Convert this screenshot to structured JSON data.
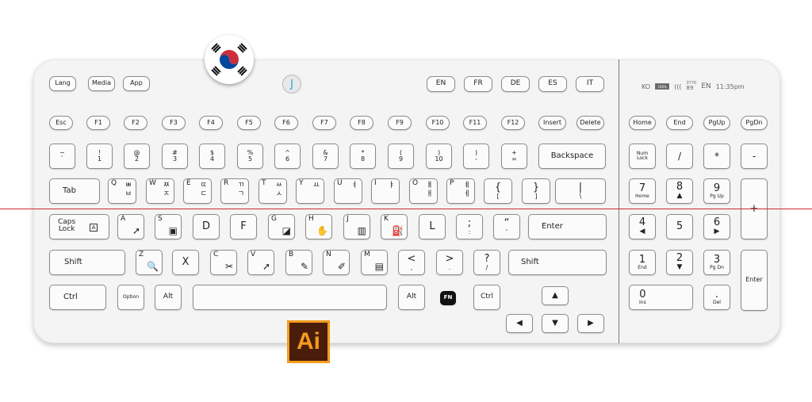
{
  "top_row": {
    "lang": "Lang",
    "media": "Media",
    "app": "App"
  },
  "languages": [
    "EN",
    "FR",
    "DE",
    "ES",
    "IT"
  ],
  "j_button": "J",
  "status": {
    "locale": "KO",
    "battery": "100%",
    "signal": "(((",
    "lat_top": "3770",
    "lat_bottom": "89",
    "lang": "EN",
    "time": "11:35pm"
  },
  "fn_row": [
    "Esc",
    "F1",
    "F2",
    "F3",
    "F4",
    "F5",
    "F6",
    "F7",
    "F8",
    "F9",
    "F10",
    "F11",
    "F12",
    "Insert",
    "Delete"
  ],
  "nav_row": [
    "Home",
    "End",
    "PgUp",
    "PgDn"
  ],
  "num_row": [
    {
      "hi": "~",
      "lo": "`"
    },
    {
      "hi": "!",
      "lo": "1"
    },
    {
      "hi": "@",
      "lo": "2"
    },
    {
      "hi": "#",
      "lo": "3"
    },
    {
      "hi": "$",
      "lo": "4"
    },
    {
      "hi": "%",
      "lo": "5"
    },
    {
      "hi": "^",
      "lo": "6"
    },
    {
      "hi": "&",
      "lo": "7"
    },
    {
      "hi": "*",
      "lo": "8"
    },
    {
      "hi": "(",
      "lo": "9"
    },
    {
      "hi": ")",
      "lo": "10"
    },
    {
      "hi": ")",
      "lo": "-"
    },
    {
      "hi": "+",
      "lo": "="
    }
  ],
  "backspace": "Backspace",
  "tab": "Tab",
  "q_row": [
    {
      "en": "Q",
      "ko1": "ㅃ",
      "ko2": "ㅂ"
    },
    {
      "en": "W",
      "ko1": "ㅉ",
      "ko2": "ㅈ"
    },
    {
      "en": "E",
      "ko1": "ㄸ",
      "ko2": "ㄷ"
    },
    {
      "en": "R",
      "ko1": "ㄲ",
      "ko2": "ㄱ"
    },
    {
      "en": "T",
      "ko1": "ㅆ",
      "ko2": "ㅅ"
    },
    {
      "en": "Y",
      "ko1": "",
      "ko2": "ㅛ"
    },
    {
      "en": "U",
      "ko1": "",
      "ko2": "ㅕ"
    },
    {
      "en": "I",
      "ko1": "",
      "ko2": "ㅑ"
    },
    {
      "en": "O",
      "ko1": "ㅒ",
      "ko2": "ㅐ"
    },
    {
      "en": "P",
      "ko1": "ㅖ",
      "ko2": "ㅔ"
    }
  ],
  "brackets": [
    {
      "hi": "{",
      "lo": "["
    },
    {
      "hi": "}",
      "lo": "]"
    },
    {
      "hi": "|",
      "lo": "\\"
    }
  ],
  "caps": {
    "line1": "Caps",
    "line2": "Lock",
    "badge": "A"
  },
  "a_row": [
    {
      "en": "A",
      "icon": "➚"
    },
    {
      "en": "S",
      "icon": "▣"
    },
    {
      "en": "",
      "big": "D"
    },
    {
      "en": "",
      "big": "F"
    },
    {
      "en": "G",
      "icon": "◪"
    },
    {
      "en": "H",
      "icon": "✋"
    },
    {
      "en": "J",
      "icon": "▥"
    },
    {
      "en": "K",
      "icon": "⛽"
    },
    {
      "en": "",
      "big": "L"
    }
  ],
  "a_punct": [
    {
      "hi": ";",
      "lo": ":"
    },
    {
      "hi": "“",
      "lo": "‘"
    }
  ],
  "enter": "Enter",
  "shift": "Shift",
  "z_row": [
    {
      "en": "Z",
      "icon": "🔍"
    },
    {
      "en": "",
      "big": "X"
    },
    {
      "en": "C",
      "icon": "✂"
    },
    {
      "en": "V",
      "icon": "➚"
    },
    {
      "en": "B",
      "icon": "✎"
    },
    {
      "en": "N",
      "icon": "✐"
    },
    {
      "en": "M",
      "icon": "▤"
    }
  ],
  "z_punct": [
    {
      "hi": "<",
      "lo": ","
    },
    {
      "hi": ">",
      "lo": "."
    },
    {
      "hi": "?",
      "lo": "/"
    }
  ],
  "bottom": {
    "ctrl": "Ctrl",
    "option": "Option",
    "alt": "Alt",
    "fn": "FN"
  },
  "arrows": {
    "up": "▲",
    "left": "◀",
    "down": "▼",
    "right": "▶"
  },
  "numpad": {
    "numlock1": "Num",
    "numlock2": "Lock",
    "slash": "/",
    "star": "*",
    "minus": "-",
    "plus": "+",
    "enter": "Enter",
    "n7": "7",
    "n7s": "Home",
    "n8": "8",
    "n8s": "▲",
    "n9": "9",
    "n9s": "Pg Up",
    "n4": "4",
    "n4s": "◀",
    "n5": "5",
    "n6": "6",
    "n6s": "▶",
    "n1": "1",
    "n1s": "End",
    "n2": "2",
    "n2s": "▼",
    "n3": "3",
    "n3s": "Pg Dn",
    "n0": "0",
    "n0s": "Ins",
    "dot": ".",
    "dots": "Del"
  },
  "ai_logo": "Ai"
}
